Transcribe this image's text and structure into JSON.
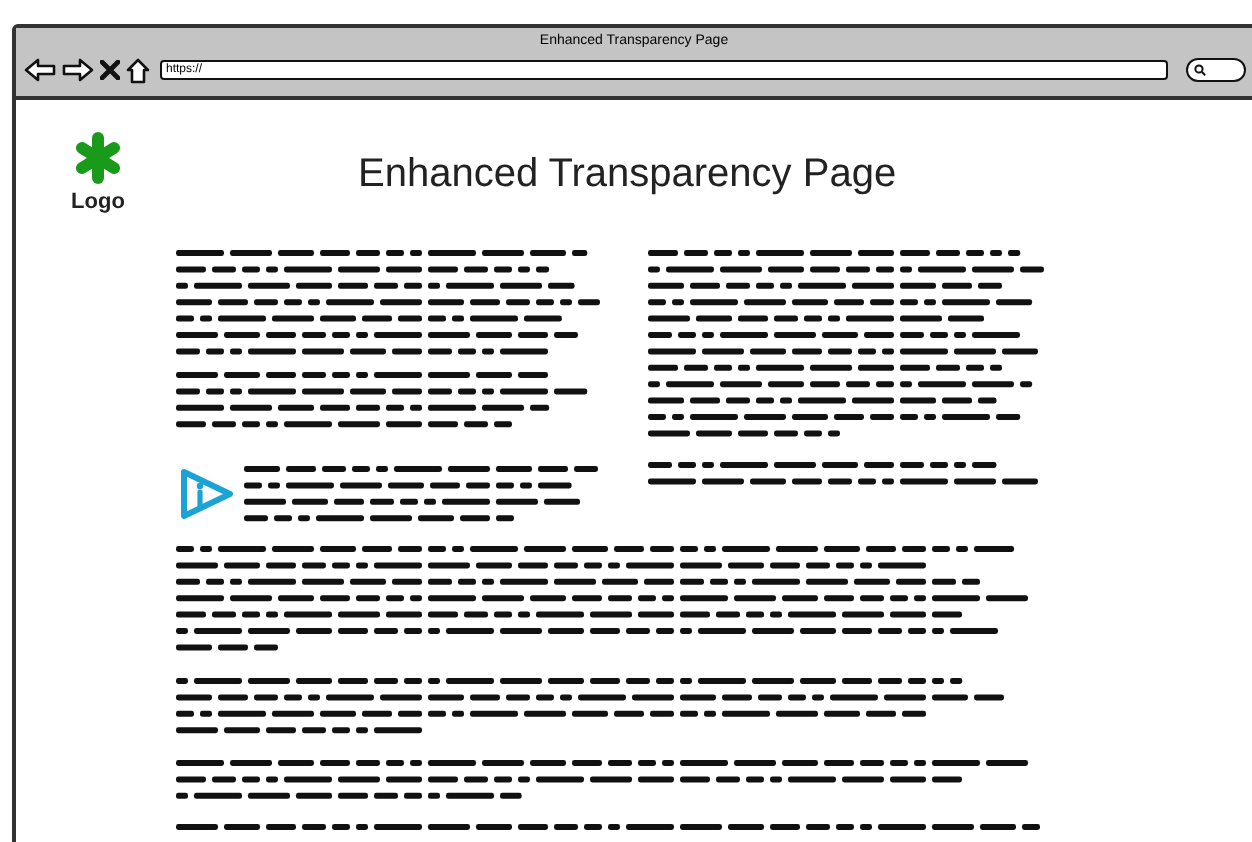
{
  "window": {
    "title": "Enhanced Transparency Page"
  },
  "address_bar": {
    "value": "https://"
  },
  "logo": {
    "label": "Logo"
  },
  "heading": "Enhanced Transparency Page"
}
